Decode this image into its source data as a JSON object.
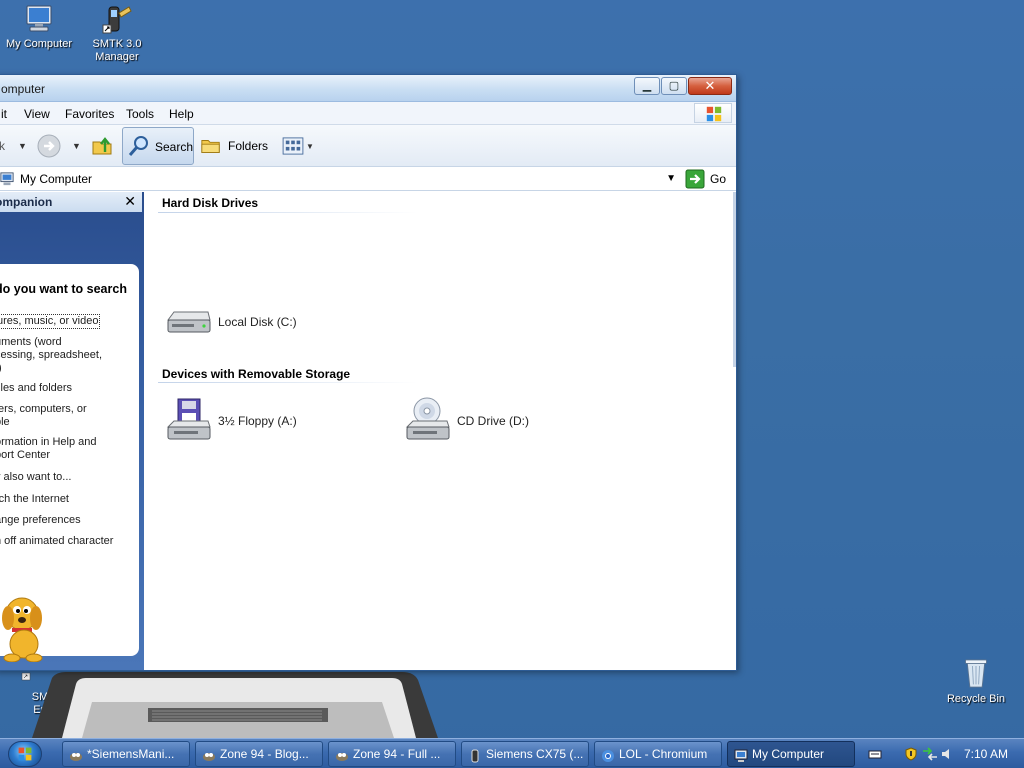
{
  "desktop": {
    "icons": [
      {
        "label_lines": [
          "My Computer"
        ]
      },
      {
        "label_lines": [
          "SMTK 3.0",
          "Manager"
        ]
      },
      {
        "label_lines": [
          "SM",
          "En"
        ]
      },
      {
        "label_lines": [
          "Recycle Bin"
        ]
      }
    ]
  },
  "window": {
    "title": "omputer",
    "menu": [
      "it",
      "View",
      "Favorites",
      "Tools",
      "Help"
    ],
    "toolbar": {
      "search_label": "Search",
      "folders_label": "Folders"
    },
    "address": {
      "value": "My Computer",
      "go_label": "Go"
    },
    "left_pane": {
      "header": "ompanion",
      "question": "do you want to search",
      "links": [
        "ures, music, or video",
        "uments (word",
        "cessing, spreadsheet,",
        ".)",
        "files and folders",
        "ters, computers, or",
        "ple",
        "ormation in Help and",
        "port Center",
        "y also want to...",
        "rch the Internet",
        "ange preferences",
        "n off animated character"
      ]
    },
    "content": {
      "groups": [
        {
          "title": "Hard Disk Drives",
          "items": [
            {
              "label": "Local Disk (C:)",
              "icon": "hard-disk-icon"
            }
          ]
        },
        {
          "title": "Devices with Removable Storage",
          "items": [
            {
              "label": "3½ Floppy (A:)",
              "icon": "floppy-drive-icon"
            },
            {
              "label": "CD Drive (D:)",
              "icon": "cd-drive-icon"
            }
          ]
        }
      ]
    }
  },
  "taskbar": {
    "tasks": [
      {
        "label": "*SiemensMani..."
      },
      {
        "label": "Zone 94 - Blog..."
      },
      {
        "label": "Zone 94 - Full ..."
      },
      {
        "label": "Siemens CX75 (..."
      },
      {
        "label": "LOL - Chromium"
      },
      {
        "label": "My Computer",
        "active": true
      }
    ],
    "clock": "7:10 AM"
  },
  "colors": {
    "desktop": "#3a6ea5",
    "taskbar": "#3b6bb0",
    "accent": "#2a4d8d"
  }
}
